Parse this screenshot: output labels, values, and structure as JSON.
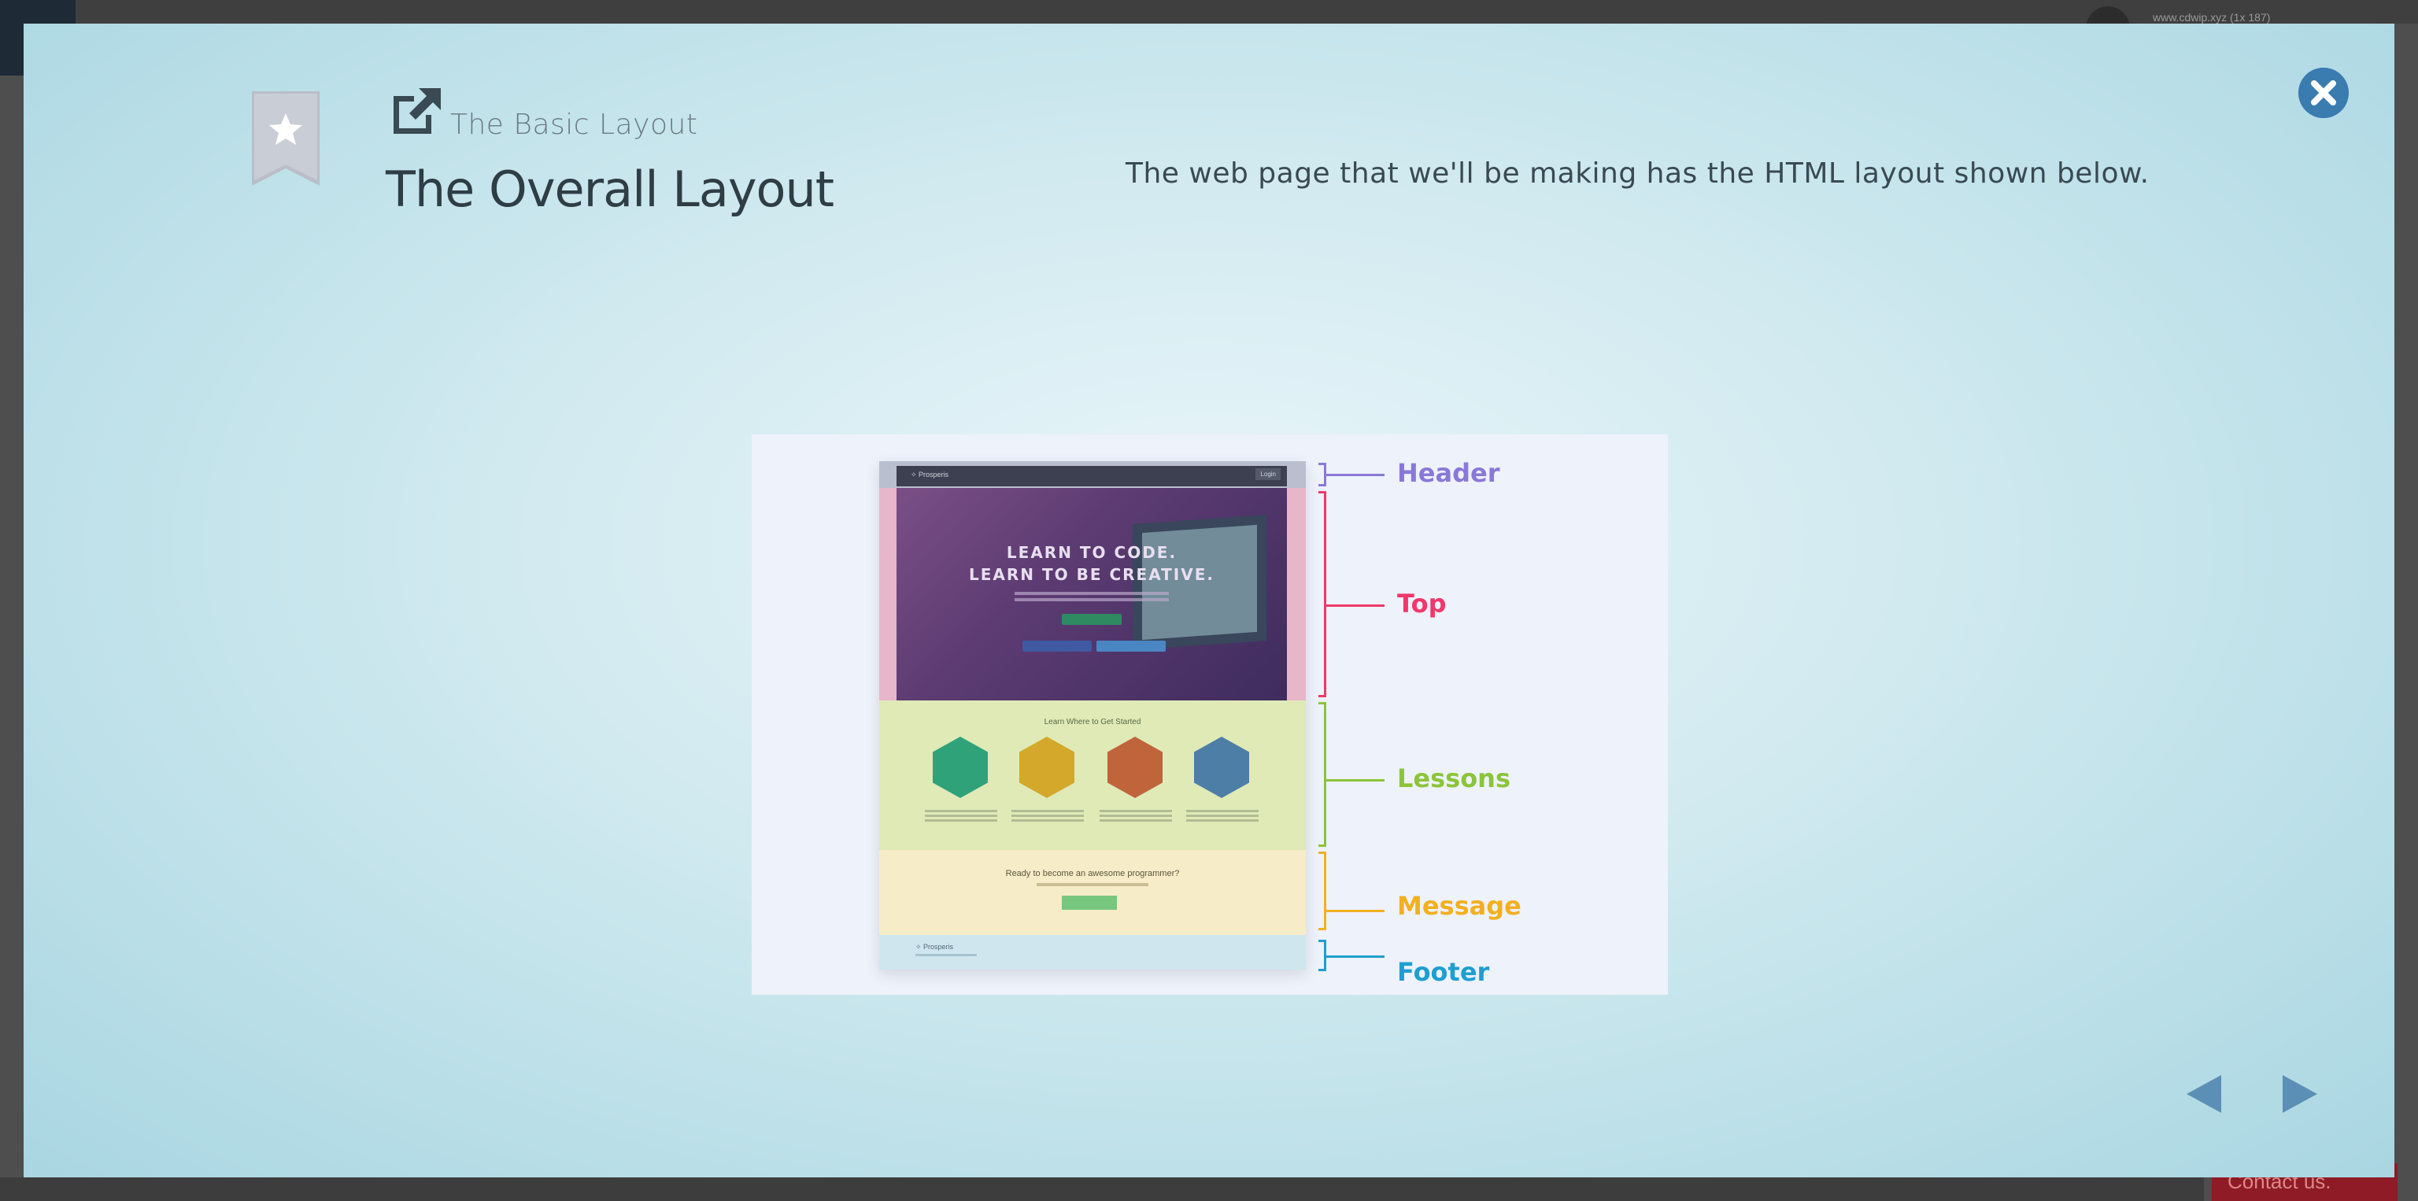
{
  "background": {
    "url_snippet": "www.cdwip.xyz (1x 187)",
    "contact_label": "Contact us."
  },
  "header": {
    "breadcrumb": "The Basic Layout",
    "title": "The Overall Layout",
    "description": "The web page that we'll be making has the HTML layout shown below."
  },
  "figure": {
    "mock": {
      "header_logo": "✧ Prosperis",
      "header_login": "Login",
      "hero_line1": "LEARN TO CODE.",
      "hero_line2": "LEARN TO BE CREATIVE.",
      "lessons_caption": "Learn Where to Get Started",
      "message_text": "Ready to become an awesome programmer?",
      "footer_logo": "✧ Prosperis"
    },
    "labels": {
      "header": "Header",
      "top": "Top",
      "lessons": "Lessons",
      "message": "Message",
      "footer": "Footer"
    },
    "colors": {
      "header": "#8a78d8",
      "top": "#f0386a",
      "lessons": "#8cc43a",
      "message": "#f2b020",
      "footer": "#1f9ed0"
    }
  },
  "icons": {
    "bookmark": "star-bookmark-icon",
    "external": "external-link-icon",
    "close": "close-icon",
    "prev": "prev-arrow-icon",
    "next": "next-arrow-icon"
  }
}
